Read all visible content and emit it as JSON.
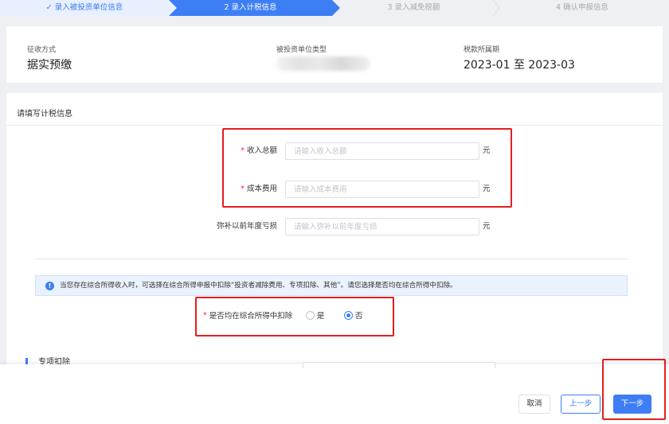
{
  "steps": [
    {
      "label": "✓ 录入被投资单位信息"
    },
    {
      "label": "2  录入计税信息"
    },
    {
      "label": "3  录入减免税额"
    },
    {
      "label": "4  确认申报信息"
    }
  ],
  "info": {
    "collection_method_label": "征收方式",
    "collection_method_value": "据实预缴",
    "invested_unit_type_label": "被投资单位类型",
    "period_label": "税款所属期",
    "period_value": "2023-01 至 2023-03"
  },
  "form": {
    "section_title": "请填写计税信息",
    "required_mark": "*",
    "total_income_label": "收入总额",
    "total_income_placeholder": "请输入收入总额",
    "cost_label": "成本费用",
    "cost_placeholder": "请输入成本费用",
    "loss_label": "弥补以前年度亏损",
    "loss_placeholder": "请输入弥补以前年度亏损",
    "unit": "元"
  },
  "notice": {
    "text": "当您存在综合所得收入时，可选择在综合所得申报中扣除“投资者减除费用、专项扣除、其他”。请您选择是否均在综合所得中扣除。"
  },
  "deduct": {
    "label": "是否均在综合所得中扣除",
    "yes": "是",
    "no": "否",
    "selected": "否"
  },
  "special": {
    "title": "专项扣除"
  },
  "footer": {
    "cancel": "取消",
    "prev": "上一步",
    "next": "下一步"
  },
  "colors": {
    "primary": "#3d7ef5",
    "highlight": "#e21e1e",
    "required": "#ff2244"
  }
}
